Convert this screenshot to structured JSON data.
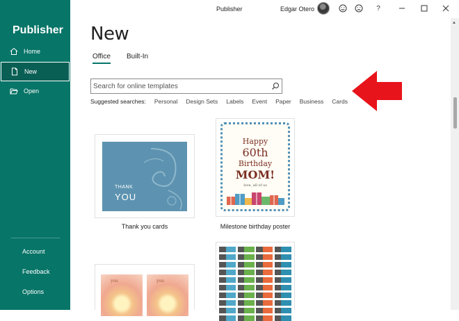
{
  "app": {
    "name": "Publisher",
    "window_title": "Publisher",
    "user_name": "Edgar Otero"
  },
  "sidebar": {
    "items": [
      {
        "label": "Home",
        "icon": "home-icon"
      },
      {
        "label": "New",
        "icon": "new-document-icon",
        "active": true
      },
      {
        "label": "Open",
        "icon": "folder-open-icon"
      }
    ],
    "bottom": [
      {
        "label": "Account"
      },
      {
        "label": "Feedback"
      },
      {
        "label": "Options"
      }
    ]
  },
  "titlebar": {
    "icons": [
      "smiley-icon",
      "frown-icon",
      "help-icon",
      "minimize-icon",
      "maximize-icon",
      "close-icon"
    ],
    "help_label": "?"
  },
  "main": {
    "title": "New",
    "tabs": [
      {
        "label": "Office",
        "active": true
      },
      {
        "label": "Built-In"
      }
    ],
    "search": {
      "placeholder": "Search for online templates",
      "value": ""
    },
    "suggested_label": "Suggested searches:",
    "suggested": [
      "Personal",
      "Design Sets",
      "Labels",
      "Event",
      "Paper",
      "Business",
      "Cards"
    ]
  },
  "templates": [
    {
      "caption": "Thank you cards",
      "preview_text_small": "THANK",
      "preview_text_large": "YOU"
    },
    {
      "caption": "Milestone birthday poster",
      "preview_lines": [
        "Happy",
        "60th",
        "Birthday",
        "MOM!",
        "love, all of us"
      ]
    },
    {
      "caption": "",
      "preview_text": "you"
    },
    {
      "caption": ""
    }
  ],
  "colors": {
    "accent": "#077568",
    "annotation_arrow": "#e8141b"
  }
}
